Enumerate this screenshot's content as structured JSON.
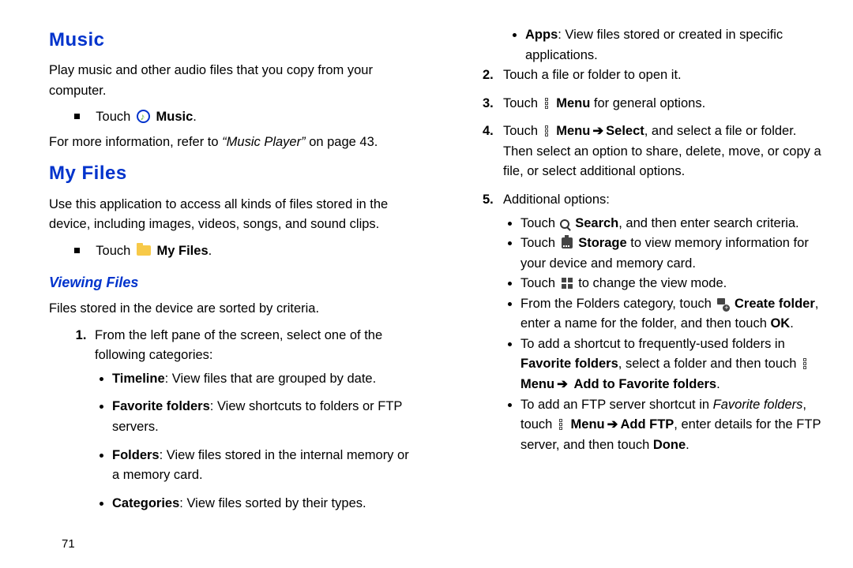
{
  "page_number": "71",
  "section_music": {
    "title": "Music",
    "intro": "Play music and other audio files that you copy from your computer.",
    "touch_prefix": "Touch ",
    "touch_label": "Music",
    "more_info_pre": "For more information, refer to ",
    "more_info_ref": "“Music Player”",
    "more_info_post": " on page 43."
  },
  "section_myfiles": {
    "title": "My Files",
    "intro": "Use this application to access all kinds of files stored in the device, including images, videos, songs, and sound clips.",
    "touch_prefix": "Touch ",
    "touch_label": "My Files"
  },
  "viewing": {
    "title": "Viewing Files",
    "sorted": "Files stored in the device are sorted by criteria.",
    "step1": "From the left pane of the screen, select one of the following categories:",
    "cat_timeline_b": "Timeline",
    "cat_timeline_t": ": View files that are grouped by date.",
    "cat_fav_b": "Favorite folders",
    "cat_fav_t": ": View shortcuts to folders or FTP servers.",
    "cat_folders_b": "Folders",
    "cat_folders_t": ": View files stored in the internal memory or a memory card.",
    "cat_cats_b": "Categories",
    "cat_cats_t": ": View files sorted by their types.",
    "cat_apps_b": "Apps",
    "cat_apps_t": ": View files stored or created in specific applications.",
    "step2": "Touch a file or folder to open it.",
    "step3_pre": "Touch ",
    "step3_menu": "Menu",
    "step3_post": " for general options.",
    "step4_pre": "Touch ",
    "step4_menu": "Menu",
    "step4_sel": "Select",
    "step4_post": ", and select a file or folder. Then select an option to share, delete, move, or copy a file, or select additional options.",
    "step5": "Additional options:",
    "opt_search_pre": "Touch ",
    "opt_search_b": "Search",
    "opt_search_post": ", and then enter search criteria.",
    "opt_storage_pre": "Touch ",
    "opt_storage_b": "Storage",
    "opt_storage_post": " to view memory information for your device and memory card.",
    "opt_view_pre": "Touch ",
    "opt_view_post": " to change the view mode.",
    "opt_create_pre": "From the Folders category, touch ",
    "opt_create_b": "Create folder",
    "opt_create_mid": ", enter a name for the folder, and then touch ",
    "opt_create_ok": "OK",
    "opt_fav_pre": "To add a shortcut to frequently-used folders in ",
    "opt_fav_b1": "Favorite folders",
    "opt_fav_mid": ", select a folder and then touch ",
    "opt_fav_menu": "Menu",
    "opt_fav_b2": "Add to Favorite folders",
    "opt_ftp_pre": "To add an FTP server shortcut in ",
    "opt_ftp_i": "Favorite folders",
    "opt_ftp_mid": ", touch ",
    "opt_ftp_menu": "Menu",
    "opt_ftp_add": "Add FTP",
    "opt_ftp_mid2": ", enter details for the FTP server, and then touch ",
    "opt_ftp_done": "Done"
  }
}
